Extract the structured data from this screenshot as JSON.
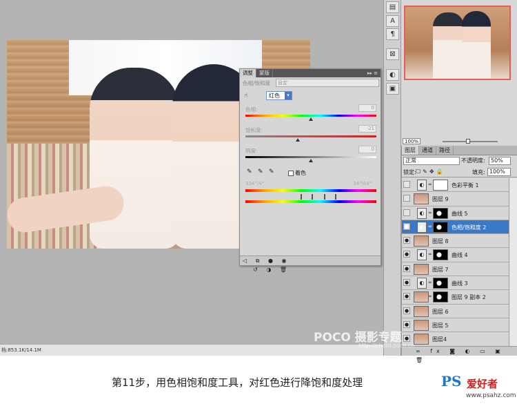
{
  "status": {
    "doc_info": "档:853.1K/14.1M"
  },
  "navigator": {
    "zoom": "100%"
  },
  "layers_panel": {
    "tabs": [
      "图层",
      "通道",
      "路径"
    ],
    "blend_mode": "正常",
    "opacity_label": "不透明度:",
    "opacity": "50%",
    "lock_label": "锁定:",
    "fill_label": "填充:",
    "fill": "100%",
    "layers": [
      {
        "name": "色彩平衡 1",
        "kind": "adjustment",
        "mask": "white",
        "visible": false,
        "selected": false
      },
      {
        "name": "图层 9",
        "kind": "photo",
        "visible": false,
        "selected": false
      },
      {
        "name": "曲线 5",
        "kind": "adjustment",
        "mask": "shapes",
        "visible": false,
        "selected": false
      },
      {
        "name": "色相/饱和度 2",
        "kind": "adjustment",
        "mask": "shapes",
        "visible": true,
        "selected": true
      },
      {
        "name": "图层 8",
        "kind": "photo",
        "visible": true,
        "selected": false
      },
      {
        "name": "曲线 4",
        "kind": "adjustment",
        "mask": "shapes",
        "visible": true,
        "selected": false
      },
      {
        "name": "图层 7",
        "kind": "photo",
        "visible": true,
        "selected": false
      },
      {
        "name": "曲线 3",
        "kind": "adjustment",
        "mask": "shapes",
        "visible": true,
        "selected": false
      },
      {
        "name": "图层 9 副本 2",
        "kind": "photo",
        "mask": "shapes",
        "visible": true,
        "selected": false
      },
      {
        "name": "图层 6",
        "kind": "photo",
        "visible": true,
        "selected": false
      },
      {
        "name": "图层 5",
        "kind": "photo",
        "visible": true,
        "selected": false
      },
      {
        "name": "图层4",
        "kind": "photo",
        "visible": true,
        "selected": false
      }
    ]
  },
  "adjustments_panel": {
    "tabs": [
      "调整",
      "蒙版"
    ],
    "preset_label": "色相/饱和度",
    "preset_value": "自定",
    "edit_channel": "红色",
    "hue": {
      "label": "色相:",
      "value": "0",
      "level": 0.5
    },
    "saturation": {
      "label": "饱和度:",
      "value": "-21",
      "level": 0.4
    },
    "lightness": {
      "label": "明度:",
      "value": "0",
      "level": 0.5
    },
    "colorize_label": "着色",
    "range_left": "334°/4°",
    "range_right": "34°\\64°"
  },
  "watermark": {
    "brand": "POCO 摄影专题",
    "url": "http://photo.poco.cn"
  },
  "caption": "第11步，用色相饱和度工具，对红色进行降饱和度处理",
  "logo": {
    "ps": "PS",
    "name": "爱好者",
    "url": "www.psahz.com"
  },
  "colors": {
    "selected_layer": "#3a78c8",
    "nav_border": "#e65c5c",
    "logo_blue": "#1e78c8"
  }
}
